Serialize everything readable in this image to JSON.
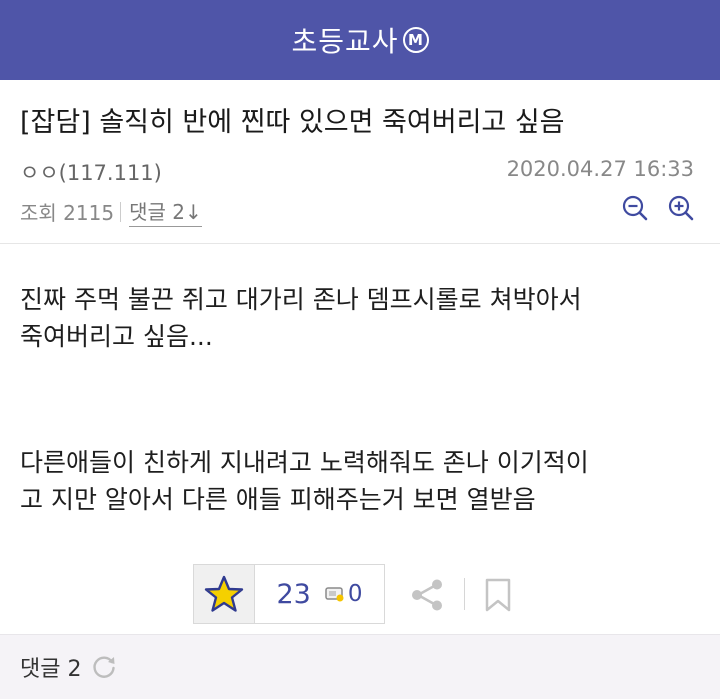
{
  "header": {
    "title": "초등교사",
    "badge": "M"
  },
  "post": {
    "title": "[잡담] 솔직히 반에 찐따 있으면 죽여버리고 싶음",
    "author": "ㅇㅇ(117.111)",
    "date": "2020.04.27 16:33",
    "views_label": "조회 2115",
    "comments_label": "댓글 2↓",
    "body": [
      "진짜 주먹 불끈 쥐고 대가리 존나 뎀프시롤로 쳐박아서",
      "죽여버리고 싶음...",
      "다른애들이 친하게 지내려고 노력해줘도 존나 이기적이",
      "고 지만 알아서 다른 애들 피해주는거 보면 열받음"
    ]
  },
  "actions": {
    "recommend_count": "23",
    "notification_count": "0"
  },
  "comment_bar": {
    "label": "댓글 2"
  },
  "colors": {
    "header": "#4f55a8",
    "accent": "#3f4aa0",
    "star": "#f5d000"
  }
}
